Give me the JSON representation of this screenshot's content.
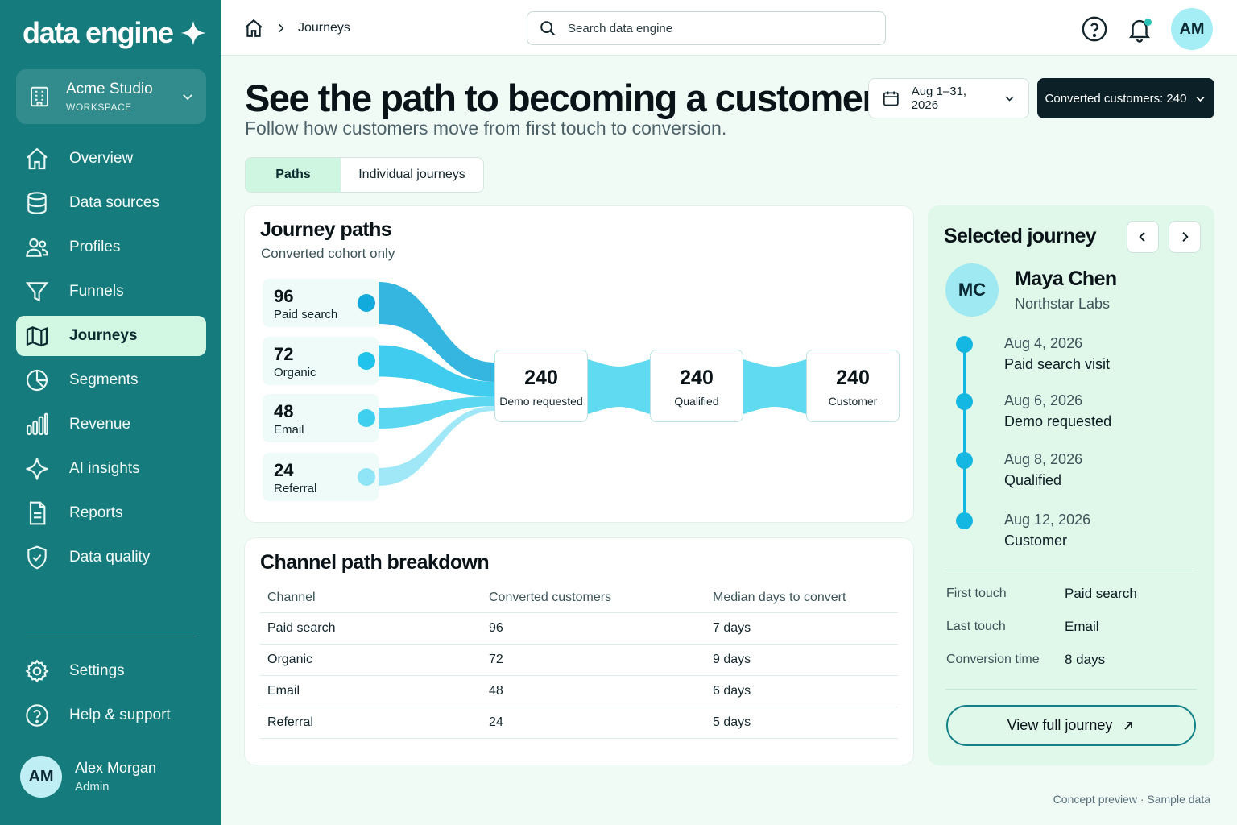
{
  "brand": {
    "name": "data engine"
  },
  "workspace": {
    "name": "Acme Studio",
    "label": "WORKSPACE"
  },
  "nav": {
    "items": [
      {
        "key": "overview",
        "label": "Overview"
      },
      {
        "key": "data-sources",
        "label": "Data sources"
      },
      {
        "key": "profiles",
        "label": "Profiles"
      },
      {
        "key": "funnels",
        "label": "Funnels"
      },
      {
        "key": "journeys",
        "label": "Journeys",
        "active": true
      },
      {
        "key": "segments",
        "label": "Segments"
      },
      {
        "key": "revenue",
        "label": "Revenue"
      },
      {
        "key": "ai-insights",
        "label": "AI insights"
      },
      {
        "key": "reports",
        "label": "Reports"
      },
      {
        "key": "data-quality",
        "label": "Data quality"
      }
    ],
    "bottom": [
      {
        "key": "settings",
        "label": "Settings"
      },
      {
        "key": "help",
        "label": "Help & support"
      }
    ]
  },
  "user": {
    "initials": "AM",
    "name": "Alex Morgan",
    "role": "Admin"
  },
  "topbar": {
    "breadcrumb": "Journeys",
    "search_placeholder": "Search data engine",
    "avatar_initials": "AM"
  },
  "header": {
    "title": "See the path to becoming a customer.",
    "subtitle": "Follow how customers move from first touch to conversion.",
    "date_range": "Aug 1–31, 2026",
    "converted_filter": "Converted customers: 240"
  },
  "tabs": [
    {
      "label": "Paths",
      "active": true
    },
    {
      "label": "Individual journeys",
      "active": false
    }
  ],
  "journey_paths": {
    "title": "Journey paths",
    "subtitle": "Converted cohort only",
    "sources": [
      {
        "value": "96",
        "label": "Paid search",
        "color": "#12a9dc"
      },
      {
        "value": "72",
        "label": "Organic",
        "color": "#1fc3ec"
      },
      {
        "value": "48",
        "label": "Email",
        "color": "#3fd0f0"
      },
      {
        "value": "24",
        "label": "Referral",
        "color": "#8fe4f6"
      }
    ],
    "stages": [
      {
        "value": "240",
        "label": "Demo requested"
      },
      {
        "value": "240",
        "label": "Qualified"
      },
      {
        "value": "240",
        "label": "Customer"
      }
    ],
    "flow_color": "#4fd6ee"
  },
  "breakdown": {
    "title": "Channel path breakdown",
    "columns": [
      "Channel",
      "Converted customers",
      "Median days to convert"
    ],
    "rows": [
      [
        "Paid search",
        "96",
        "7 days"
      ],
      [
        "Organic",
        "72",
        "9 days"
      ],
      [
        "Email",
        "48",
        "6 days"
      ],
      [
        "Referral",
        "24",
        "5 days"
      ]
    ]
  },
  "selected_journey": {
    "title": "Selected journey",
    "initials": "MC",
    "name": "Maya Chen",
    "company": "Northstar Labs",
    "timeline": [
      {
        "date": "Aug 4, 2026",
        "event": "Paid search visit"
      },
      {
        "date": "Aug 6, 2026",
        "event": "Demo requested"
      },
      {
        "date": "Aug 8, 2026",
        "event": "Qualified"
      },
      {
        "date": "Aug 12, 2026",
        "event": "Customer"
      }
    ],
    "details": [
      {
        "label": "First touch",
        "value": "Paid search"
      },
      {
        "label": "Last touch",
        "value": "Email"
      },
      {
        "label": "Conversion time",
        "value": "8 days"
      }
    ],
    "cta": "View full journey"
  },
  "footer": "Concept preview · Sample data",
  "colors": {
    "sidebar": "#167b7d",
    "accent": "#14b6e2",
    "active_nav": "#d2f7e3",
    "dark_button": "#0b2027"
  }
}
